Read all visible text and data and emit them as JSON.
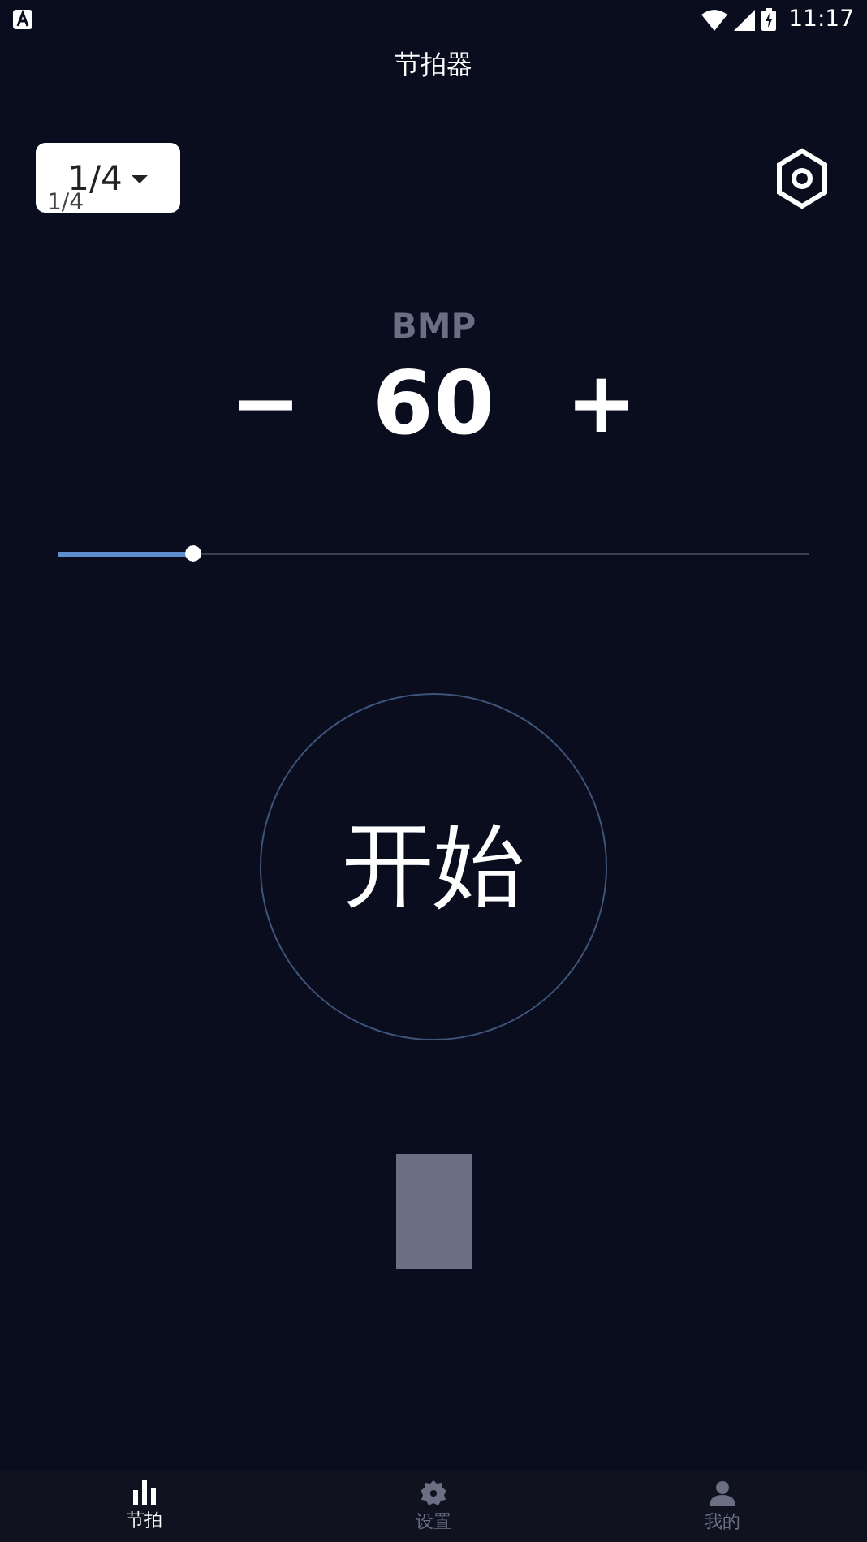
{
  "status_bar": {
    "time": "11:17"
  },
  "title": "节拍器",
  "beat_selector": {
    "value": "1/4",
    "label": "1/4"
  },
  "bpm": {
    "label": "BMP",
    "minus": "−",
    "value": "60",
    "plus": "+",
    "level": 0.18
  },
  "start_button": {
    "label": "开始"
  },
  "nav": [
    {
      "label": "节拍",
      "kind": "bars",
      "selected": true
    },
    {
      "label": "设置",
      "kind": "gear",
      "selected": false
    },
    {
      "label": "我的",
      "kind": "person",
      "selected": false
    }
  ]
}
